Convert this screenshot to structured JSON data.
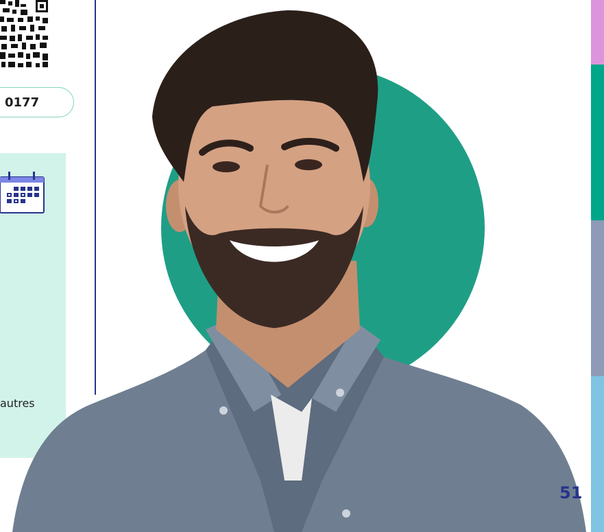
{
  "reference_code": "0177",
  "info_text": "autres",
  "page_number": "51",
  "colors": {
    "accent_teal": "#1f9e86",
    "panel_mint": "#d2f3ea",
    "rule_navy": "#27348b",
    "tab_colors": [
      "#dc95dd",
      "#00a68a",
      "#8d9bb8",
      "#7fc4e2"
    ]
  },
  "icons": [
    "qr-code-icon",
    "calendar-icon"
  ]
}
